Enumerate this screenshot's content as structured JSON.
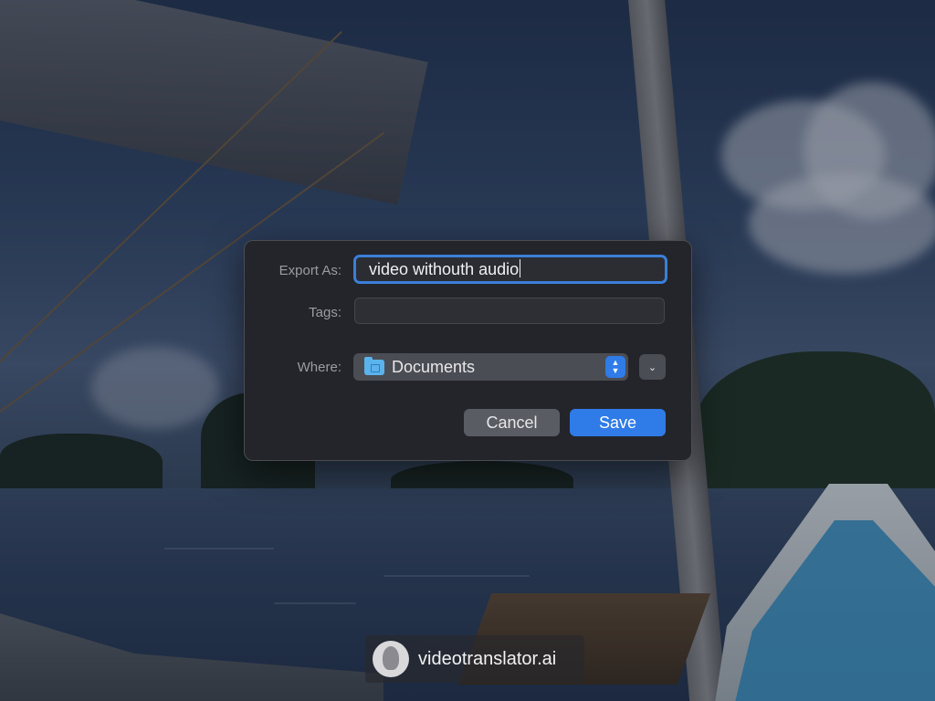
{
  "dialog": {
    "export_as_label": "Export As:",
    "filename_value": "video withouth audio",
    "tags_label": "Tags:",
    "tags_value": "",
    "where_label": "Where:",
    "where_value": "Documents",
    "where_icon": "folder-icon",
    "cancel_label": "Cancel",
    "save_label": "Save"
  },
  "watermark": {
    "text": "videotranslator.ai"
  },
  "colors": {
    "accent": "#2f7be8",
    "dialog_bg": "#23252b",
    "focus_ring": "#3b7fd8"
  }
}
